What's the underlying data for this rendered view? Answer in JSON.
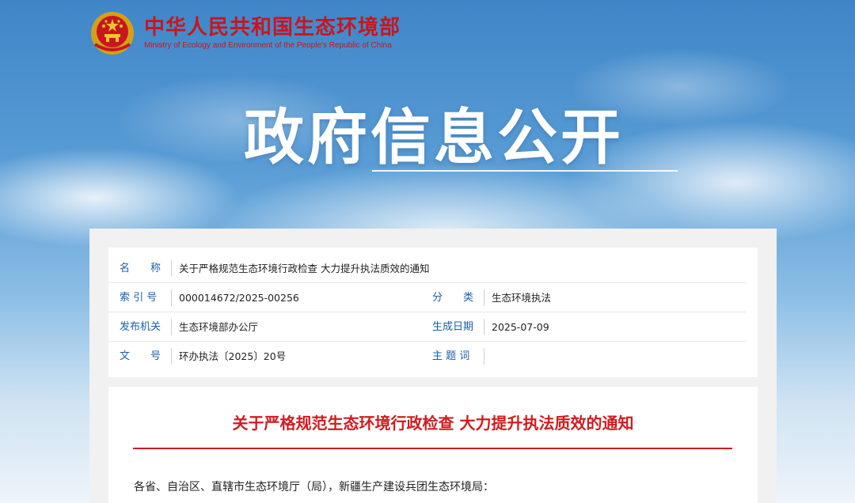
{
  "header": {
    "ministry_cn": "中华人民共和国生态环境部",
    "ministry_en": "Ministry of Ecology and Environment of the People's Republic of China",
    "hero_title": "政府信息公开"
  },
  "meta": {
    "name_label": "名　　称",
    "name_value": "关于严格规范生态环境行政检查 大力提升执法质效的通知",
    "index_label": "索 引 号",
    "index_value": "000014672/2025-00256",
    "category_label": "分　　类",
    "category_value": "生态环境执法",
    "issuer_label": "发布机关",
    "issuer_value": "生态环境部办公厅",
    "date_label": "生成日期",
    "date_value": "2025-07-09",
    "docno_label": "文　　号",
    "docno_value": "环办执法〔2025〕20号",
    "subject_label": "主 题 词",
    "subject_value": ""
  },
  "document": {
    "title": "关于严格规范生态环境行政检查 大力提升执法质效的通知",
    "salutation": "各省、自治区、直辖市生态环境厅（局），新疆生产建设兵团生态环境局："
  },
  "colors": {
    "brand_red": "#c8161d",
    "label_blue": "#1a5fa8"
  }
}
